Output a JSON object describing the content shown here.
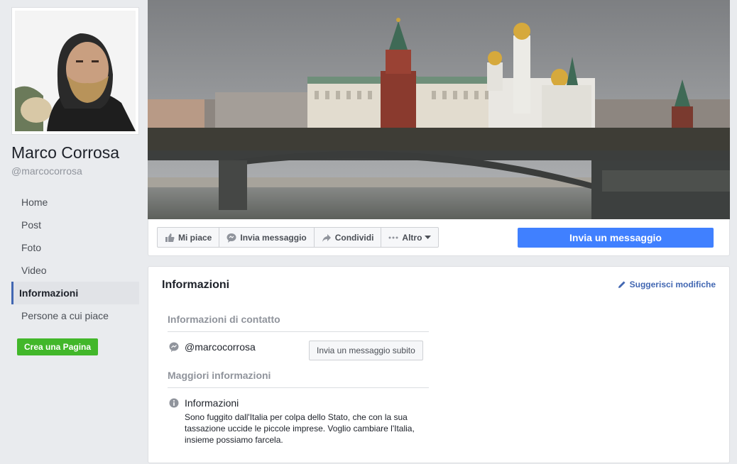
{
  "profile": {
    "name": "Marco Corrosa",
    "username": "@marcocorrosa"
  },
  "nav": {
    "items": [
      {
        "label": "Home"
      },
      {
        "label": "Post"
      },
      {
        "label": "Foto"
      },
      {
        "label": "Video"
      },
      {
        "label": "Informazioni",
        "active": true
      },
      {
        "label": "Persone a cui piace"
      }
    ],
    "create_page": "Crea una Pagina"
  },
  "actions": {
    "like": "Mi piace",
    "message": "Invia messaggio",
    "share": "Condividi",
    "more": "Altro",
    "primary": "Invia un messaggio"
  },
  "info": {
    "title": "Informazioni",
    "suggest": "Suggerisci modifiche",
    "contact_heading": "Informazioni di contatto",
    "messenger_handle": "@marcocorrosa",
    "message_now": "Invia un messaggio subito",
    "more_heading": "Maggiori informazioni",
    "about_label": "Informazioni",
    "about_text": "Sono fuggito dall'Italia per colpa dello Stato, che con la sua tassazione uccide le piccole imprese. Voglio cambiare l'Italia, insieme possiamo farcela."
  },
  "colors": {
    "accent": "#4267b2",
    "primary_button": "#4080ff",
    "create_button": "#42b72a",
    "background": "#e9ebee"
  },
  "icons": {
    "like": "thumbs-up-icon",
    "message": "speech-bubble-icon",
    "share": "share-arrow-icon",
    "more": "ellipsis-icon",
    "suggest": "pencil-icon",
    "messenger": "messenger-icon",
    "info": "info-circle-icon"
  }
}
